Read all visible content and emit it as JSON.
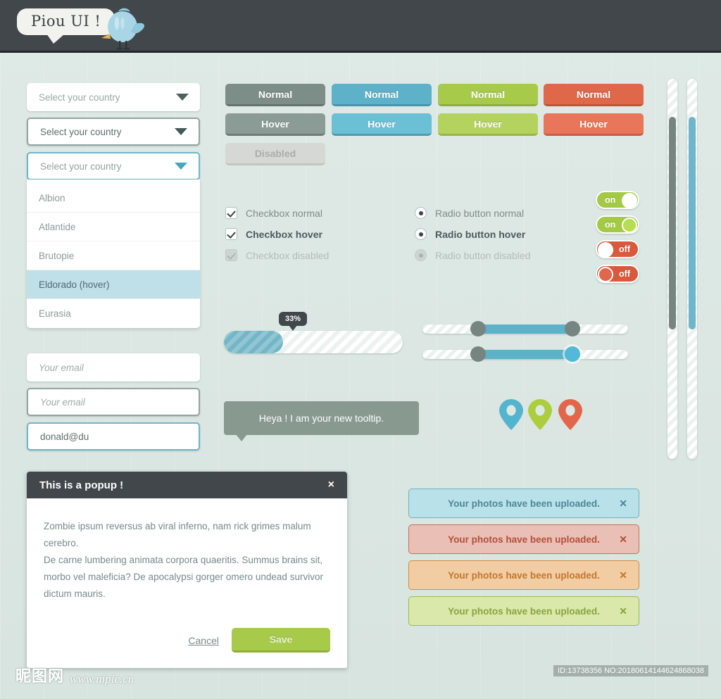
{
  "header": {
    "logo_text": "Piou UI !",
    "bird_icon": "bird-icon"
  },
  "selects": {
    "placeholder": "Select your country",
    "items": [
      {
        "label": "Select your country",
        "state": "normal"
      },
      {
        "label": "Select your country",
        "state": "hover"
      },
      {
        "label": "Select your country",
        "state": "active"
      }
    ],
    "options": [
      {
        "label": "Albion",
        "state": "normal"
      },
      {
        "label": "Atlantide",
        "state": "normal"
      },
      {
        "label": "Brutopie",
        "state": "normal"
      },
      {
        "label": "Eldorado (hover)",
        "state": "hover"
      },
      {
        "label": "Eurasia",
        "state": "normal"
      }
    ]
  },
  "inputs": [
    {
      "value": "",
      "placeholder": "Your email",
      "state": "normal"
    },
    {
      "value": "",
      "placeholder": "Your email",
      "state": "hover"
    },
    {
      "value": "donald@du",
      "placeholder": "Your email",
      "state": "focus"
    }
  ],
  "buttons": {
    "normal_label": "Normal",
    "hover_label": "Hover",
    "disabled_label": "Disabled",
    "colors": {
      "gray": "#7d8e89",
      "blue": "#5db2c9",
      "green": "#a8ca4b",
      "red": "#df674a",
      "disabled": "#d5d8d4"
    }
  },
  "checkboxes": [
    {
      "label": "Checkbox normal",
      "checked": true,
      "state": "normal"
    },
    {
      "label": "Checkbox hover",
      "checked": true,
      "state": "hover"
    },
    {
      "label": "Checkbox disabled",
      "checked": true,
      "state": "disabled"
    }
  ],
  "radios": [
    {
      "label": "Radio button normal",
      "checked": true,
      "state": "normal"
    },
    {
      "label": "Radio button hover",
      "checked": true,
      "state": "hover"
    },
    {
      "label": "Radio button disabled",
      "checked": true,
      "state": "disabled"
    }
  ],
  "toggles": [
    {
      "label": "on",
      "state": "normal",
      "value": "on"
    },
    {
      "label": "on",
      "state": "hover",
      "value": "on"
    },
    {
      "label": "off",
      "state": "normal",
      "value": "off"
    },
    {
      "label": "off",
      "state": "hover",
      "value": "off"
    }
  ],
  "progress": {
    "percent": 33,
    "tooltip_label": "33%"
  },
  "sliders": [
    {
      "start_percent": 27,
      "end_percent": 73,
      "handle_color": "#76857f",
      "state": "normal"
    },
    {
      "start_percent": 27,
      "end_percent": 73,
      "handle_color": "#52b9d6",
      "state": "hover"
    }
  ],
  "tooltip": {
    "text": "Heya ! I am your new tooltip."
  },
  "pins": [
    {
      "name": "map-pin-blue",
      "color": "#53b4cd"
    },
    {
      "name": "map-pin-green",
      "color": "#aecd3e"
    },
    {
      "name": "map-pin-orange",
      "color": "#e2674a"
    }
  ],
  "scrollbars": [
    {
      "thumb_color": "#76857f",
      "thumb_top_percent": 10,
      "thumb_height_percent": 56
    },
    {
      "thumb_color": "#6eb6cb",
      "thumb_top_percent": 10,
      "thumb_height_percent": 56
    }
  ],
  "popup": {
    "title": "This is a popup !",
    "close_label": "×",
    "paragraph1": "Zombie ipsum reversus ab viral inferno, nam rick grimes malum cerebro.",
    "paragraph2": "De carne lumbering animata corpora quaeritis. Summus brains sit, morbo vel maleficia? De apocalypsi gorger omero undead survivor dictum mauris.",
    "cancel_label": "Cancel",
    "save_label": "Save"
  },
  "alerts": [
    {
      "text": "Your photos have been uploaded.",
      "close_label": "✕",
      "type": "info"
    },
    {
      "text": "Your photos have been uploaded.",
      "close_label": "✕",
      "type": "error"
    },
    {
      "text": "Your photos have been uploaded.",
      "close_label": "✕",
      "type": "warning"
    },
    {
      "text": "Your photos have been uploaded.",
      "close_label": "✕",
      "type": "success"
    }
  ],
  "footer": {
    "watermark_cn": "昵图网",
    "watermark_url": "www.nipic.cn",
    "id_text": "ID:13738356 NO:20180614144624868038"
  }
}
